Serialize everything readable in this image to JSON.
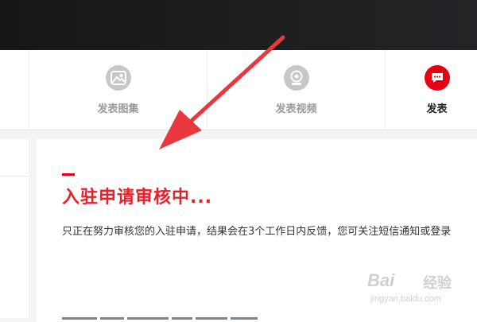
{
  "publish": {
    "items": [
      {
        "label": "发表图集",
        "icon": "image-gallery-icon"
      },
      {
        "label": "发表视频",
        "icon": "video-camera-icon"
      },
      {
        "label": "发表",
        "icon": "chat-bubble-icon"
      }
    ]
  },
  "status": {
    "title": "入驻申请审核中...",
    "description": "只正在努力审核您的入驻申请，结果会在3个工作日内反馈，您可关注短信通知或登录"
  },
  "watermark": {
    "brand": "Bai",
    "brand_cn": "经验",
    "url": "jingyan.baidu.com"
  },
  "colors": {
    "accent_red": "#e60012",
    "title_red": "#e8202a",
    "topbar": "#1d1d1d",
    "annotation_arrow": "#e8383d"
  }
}
